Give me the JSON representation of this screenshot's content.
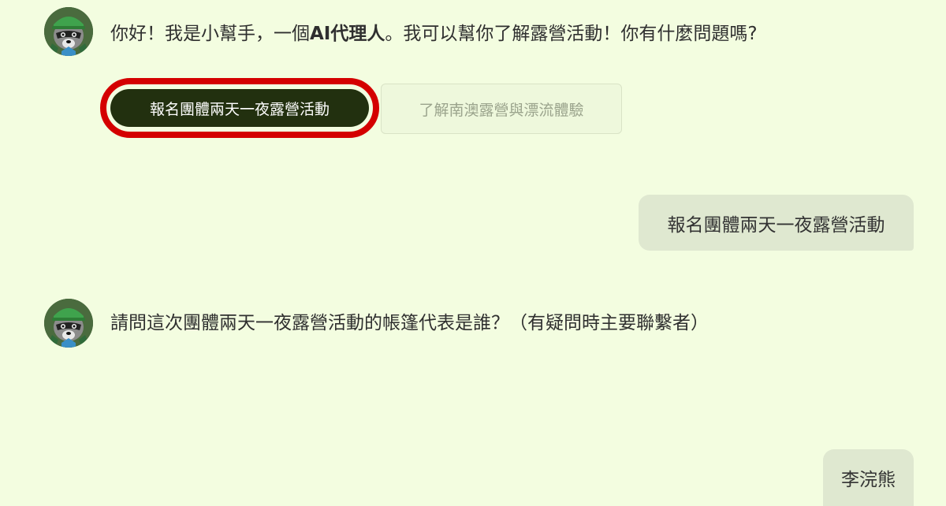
{
  "messages": {
    "bot_1": {
      "avatar": "raccoon-avatar-icon",
      "text_part1": "你好！我是小幫手，一個",
      "text_bold": "AI代理人",
      "text_part2": "。我可以幫你了解露營活動！你有什麼問題嗎?"
    },
    "quick_replies": [
      {
        "label": "報名團體兩天一夜露營活動",
        "selected": true
      },
      {
        "label": "了解南澳露營與漂流體驗",
        "selected": false
      }
    ],
    "user_1": {
      "text": "報名團體兩天一夜露營活動"
    },
    "bot_2": {
      "avatar": "raccoon-avatar-icon",
      "text": "請問這次團體兩天一夜露營活動的帳篷代表是誰？（有疑問時主要聯繫者）"
    },
    "user_2": {
      "text": "李浣熊"
    }
  },
  "colors": {
    "background": "#f3fde0",
    "primary_button": "#22300f",
    "highlight_ring": "#d40000",
    "user_bubble": "#dfe8d0"
  }
}
